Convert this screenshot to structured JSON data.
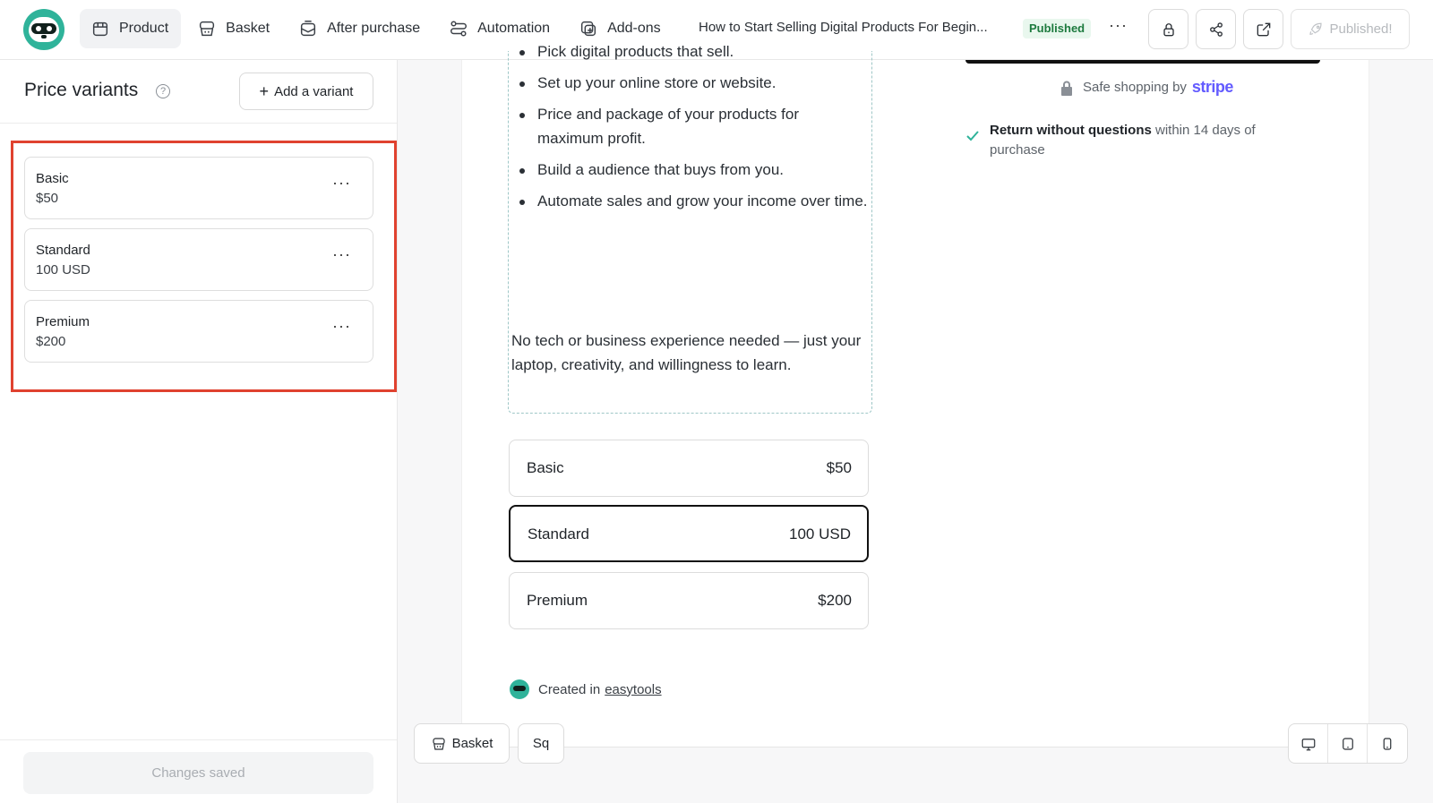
{
  "nav": {
    "items": [
      {
        "label": "Product",
        "icon": "box-icon",
        "active": true
      },
      {
        "label": "Basket",
        "icon": "basket-icon",
        "active": false
      },
      {
        "label": "After purchase",
        "icon": "mail-icon",
        "active": false
      },
      {
        "label": "Automation",
        "icon": "automation-icon",
        "active": false
      },
      {
        "label": "Add-ons",
        "icon": "addons-icon",
        "active": false
      }
    ],
    "product_title": "How to Start Selling Digital Products For Begin...",
    "status_badge": "Published",
    "more": "···",
    "published_button": "Published!"
  },
  "left_panel": {
    "title": "Price variants",
    "help": "?",
    "add_variant_label": "Add a variant",
    "add_variant_plus": "+",
    "variants": [
      {
        "name": "Basic",
        "price": "$50",
        "menu": "···"
      },
      {
        "name": "Standard",
        "price": "100 USD",
        "menu": "···"
      },
      {
        "name": "Premium",
        "price": "$200",
        "menu": "···"
      }
    ],
    "footer_label": "Changes saved",
    "highlight_color": "#e0422f"
  },
  "preview": {
    "bullets": [
      "Pick digital products that sell.",
      "Set up your online store or website.",
      "Price and package of your products for maximum profit.",
      "Build a audience that buys from you.",
      "Automate sales and grow your income over time."
    ],
    "closing": "No tech or business experience needed — just your laptop, creativity, and willingness to learn.",
    "price_options": [
      {
        "name": "Basic",
        "price": "$50",
        "selected": false
      },
      {
        "name": "Standard",
        "price": "100 USD",
        "selected": true
      },
      {
        "name": "Premium",
        "price": "$200",
        "selected": false
      }
    ],
    "created_prefix": "Created in",
    "created_link": "easytools",
    "safe_text": "Safe shopping by",
    "stripe": "stripe",
    "return_bold": "Return without questions",
    "return_rest": " within 14 days of purchase"
  },
  "bottom": {
    "basket_label": "Basket",
    "sq_label": "Sq"
  },
  "colors": {
    "accent": "#2fb39a",
    "stripe": "#635bff",
    "badge_bg": "#e9f7ee",
    "badge_text": "#1d7a3e"
  }
}
